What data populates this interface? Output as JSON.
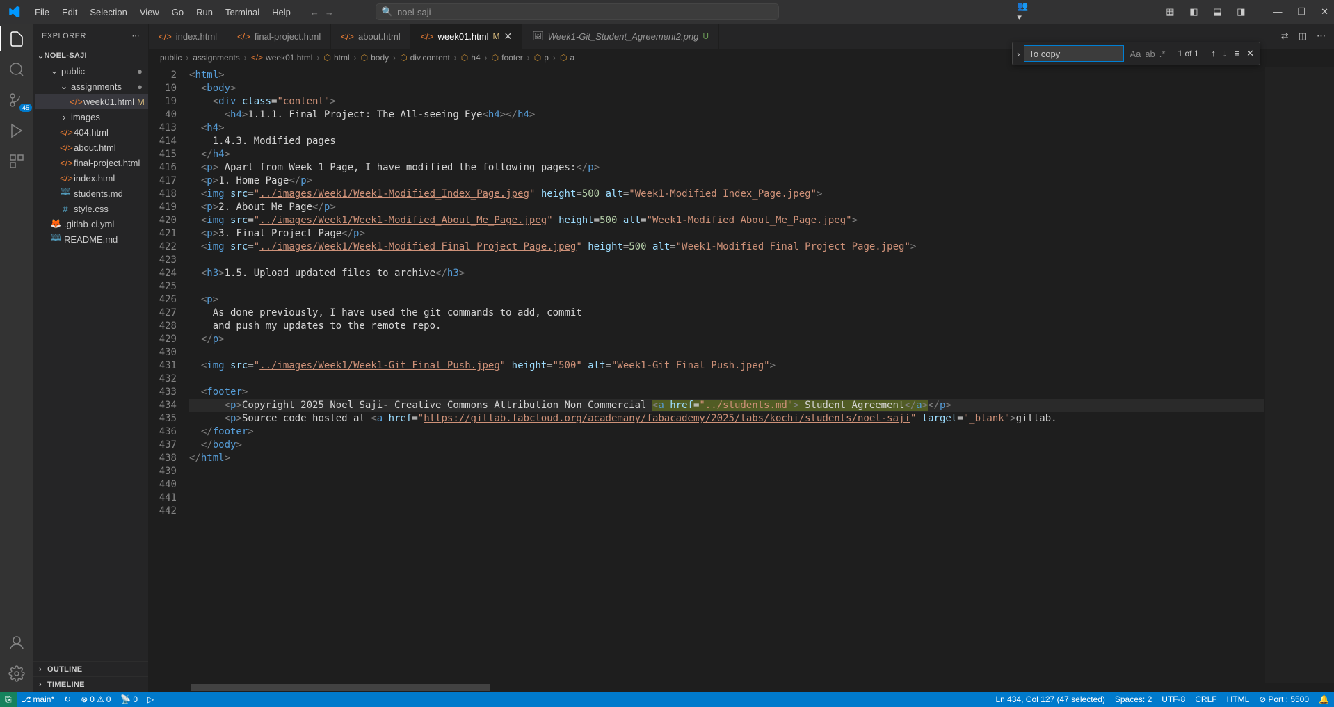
{
  "menubar": [
    "File",
    "Edit",
    "Selection",
    "View",
    "Go",
    "Run",
    "Terminal",
    "Help"
  ],
  "search_placeholder": "noel-saji",
  "activity_badge": "45",
  "explorer": {
    "title": "EXPLORER",
    "project": "NOEL-SAJI",
    "tree": [
      {
        "type": "folder",
        "name": "public",
        "indent": 1,
        "open": true,
        "dot": true
      },
      {
        "type": "folder",
        "name": "assignments",
        "indent": 2,
        "open": true,
        "dot": true
      },
      {
        "type": "file",
        "name": "week01.html",
        "indent": 3,
        "icon": "orange",
        "active": true,
        "status": "M"
      },
      {
        "type": "folder",
        "name": "images",
        "indent": 2,
        "open": false
      },
      {
        "type": "file",
        "name": "404.html",
        "indent": 2,
        "icon": "orange"
      },
      {
        "type": "file",
        "name": "about.html",
        "indent": 2,
        "icon": "orange"
      },
      {
        "type": "file",
        "name": "final-project.html",
        "indent": 2,
        "icon": "orange"
      },
      {
        "type": "file",
        "name": "index.html",
        "indent": 2,
        "icon": "orange"
      },
      {
        "type": "file",
        "name": "students.md",
        "indent": 2,
        "icon": "blue"
      },
      {
        "type": "file",
        "name": "style.css",
        "indent": 2,
        "icon": "blue"
      },
      {
        "type": "file",
        "name": ".gitlab-ci.yml",
        "indent": 1,
        "icon": "red"
      },
      {
        "type": "file",
        "name": "README.md",
        "indent": 1,
        "icon": "blue"
      }
    ],
    "sections": [
      "OUTLINE",
      "TIMELINE"
    ]
  },
  "tabs": [
    {
      "label": "index.html",
      "icon": "orange"
    },
    {
      "label": "final-project.html",
      "icon": "orange"
    },
    {
      "label": "about.html",
      "icon": "orange"
    },
    {
      "label": "week01.html",
      "icon": "orange",
      "active": true,
      "status": "M",
      "close": true
    },
    {
      "label": "Week1-Git_Student_Agreement2.png",
      "icon": "img",
      "status": "U",
      "italic": true
    }
  ],
  "breadcrumbs": [
    "public",
    "assignments",
    "week01.html",
    "html",
    "body",
    "div.content",
    "h4",
    "footer",
    "p",
    "a"
  ],
  "find": {
    "value": "To copy",
    "count": "1 of 1"
  },
  "gutter_lines": [
    "2",
    "10",
    "19",
    "40",
    "413",
    "414",
    "415",
    "416",
    "417",
    "418",
    "419",
    "420",
    "421",
    "422",
    "423",
    "424",
    "425",
    "426",
    "427",
    "428",
    "429",
    "430",
    "431",
    "432",
    "433",
    "434",
    "435",
    "436",
    "437",
    "438",
    "439",
    "440",
    "441",
    "442"
  ],
  "code_lines": [
    {
      "indent": 0,
      "html": "<span class='t-br'>&lt;</span><span class='t-tag'>html</span><span class='t-br'>&gt;</span>"
    },
    {
      "indent": 1,
      "html": "<span class='t-br'>&lt;</span><span class='t-tag'>body</span><span class='t-br'>&gt;</span>"
    },
    {
      "indent": 2,
      "html": "<span class='t-br'>&lt;</span><span class='t-tag'>div</span> <span class='t-attr'>class</span>=<span class='t-str'>\"content\"</span><span class='t-br'>&gt;</span>"
    },
    {
      "indent": 3,
      "html": "<span class='t-br'>&lt;</span><span class='t-tag'>h4</span><span class='t-br'>&gt;</span>1.1.1. Final Project: The All-seeing Eye<span class='t-br'>&lt;</span><span class='t-tag'>h4</span><span class='t-br'>&gt;&lt;/</span><span class='t-tag'>h4</span><span class='t-br'>&gt;</span>"
    },
    {
      "indent": 1,
      "html": "<span class='t-br'>&lt;</span><span class='t-tag'>h4</span><span class='t-br'>&gt;</span>"
    },
    {
      "indent": 2,
      "html": "1.4.3. Modified pages"
    },
    {
      "indent": 1,
      "html": "<span class='t-br'>&lt;/</span><span class='t-tag'>h4</span><span class='t-br'>&gt;</span>"
    },
    {
      "indent": 1,
      "html": "<span class='t-br'>&lt;</span><span class='t-tag'>p</span><span class='t-br'>&gt;</span> Apart from Week 1 Page, I have modified the following pages:<span class='t-br'>&lt;/</span><span class='t-tag'>p</span><span class='t-br'>&gt;</span>"
    },
    {
      "indent": 1,
      "html": "<span class='t-br'>&lt;</span><span class='t-tag'>p</span><span class='t-br'>&gt;</span>1. Home Page<span class='t-br'>&lt;/</span><span class='t-tag'>p</span><span class='t-br'>&gt;</span>"
    },
    {
      "indent": 1,
      "html": "<span class='t-br'>&lt;</span><span class='t-tag'>img</span> <span class='t-attr'>src</span>=<span class='t-str'>\"</span><span class='t-link'>../images/Week1/Week1-Modified_Index_Page.jpeg</span><span class='t-str'>\"</span> <span class='t-attr'>height</span>=<span class='t-num'>500</span> <span class='t-attr'>alt</span>=<span class='t-str'>\"Week1-Modified Index_Page.jpeg\"</span><span class='t-br'>&gt;</span>"
    },
    {
      "indent": 1,
      "html": "<span class='t-br'>&lt;</span><span class='t-tag'>p</span><span class='t-br'>&gt;</span>2. About Me Page<span class='t-br'>&lt;/</span><span class='t-tag'>p</span><span class='t-br'>&gt;</span>"
    },
    {
      "indent": 1,
      "html": "<span class='t-br'>&lt;</span><span class='t-tag'>img</span> <span class='t-attr'>src</span>=<span class='t-str'>\"</span><span class='t-link'>../images/Week1/Week1-Modified_About_Me_Page.jpeg</span><span class='t-str'>\"</span> <span class='t-attr'>height</span>=<span class='t-num'>500</span> <span class='t-attr'>alt</span>=<span class='t-str'>\"Week1-Modified About_Me_Page.jpeg\"</span><span class='t-br'>&gt;</span>"
    },
    {
      "indent": 1,
      "html": "<span class='t-br'>&lt;</span><span class='t-tag'>p</span><span class='t-br'>&gt;</span>3. Final Project Page<span class='t-br'>&lt;/</span><span class='t-tag'>p</span><span class='t-br'>&gt;</span>"
    },
    {
      "indent": 1,
      "html": "<span class='t-br'>&lt;</span><span class='t-tag'>img</span> <span class='t-attr'>src</span>=<span class='t-str'>\"</span><span class='t-link'>../images/Week1/Week1-Modified_Final_Project_Page.jpeg</span><span class='t-str'>\"</span> <span class='t-attr'>height</span>=<span class='t-num'>500</span> <span class='t-attr'>alt</span>=<span class='t-str'>\"Week1-Modified Final_Project_Page.jpeg\"</span><span class='t-br'>&gt;</span>"
    },
    {
      "indent": 1,
      "html": ""
    },
    {
      "indent": 1,
      "html": "<span class='t-br'>&lt;</span><span class='t-tag'>h3</span><span class='t-br'>&gt;</span>1.5. Upload updated files to archive<span class='t-br'>&lt;/</span><span class='t-tag'>h3</span><span class='t-br'>&gt;</span>"
    },
    {
      "indent": 1,
      "html": ""
    },
    {
      "indent": 1,
      "html": "<span class='t-br'>&lt;</span><span class='t-tag'>p</span><span class='t-br'>&gt;</span>"
    },
    {
      "indent": 2,
      "html": "As done previously, I have used the git commands to add, commit"
    },
    {
      "indent": 2,
      "html": "and push my updates to the remote repo."
    },
    {
      "indent": 1,
      "html": "<span class='t-br'>&lt;/</span><span class='t-tag'>p</span><span class='t-br'>&gt;</span>"
    },
    {
      "indent": 1,
      "html": ""
    },
    {
      "indent": 1,
      "html": "<span class='t-br'>&lt;</span><span class='t-tag'>img</span> <span class='t-attr'>src</span>=<span class='t-str'>\"</span><span class='t-link'>../images/Week1/Week1-Git_Final_Push.jpeg</span><span class='t-str'>\"</span> <span class='t-attr'>height</span>=<span class='t-str'>\"500\"</span> <span class='t-attr'>alt</span>=<span class='t-str'>\"Week1-Git_Final_Push.jpeg\"</span><span class='t-br'>&gt;</span>"
    },
    {
      "indent": 1,
      "html": ""
    },
    {
      "indent": 1,
      "html": "<span class='t-br'>&lt;</span><span class='t-tag'>footer</span><span class='t-br'>&gt;</span>"
    },
    {
      "indent": 3,
      "html": "<span class='t-br'>&lt;</span><span class='t-tag'>p</span><span class='t-br'>&gt;</span>Copyright 2025 Noel Saji- Creative Commons Attribution Non Commercial <span class='highlight-find'><span class='t-br'>&lt;</span><span class='t-tag'>a</span> <span class='t-attr'>href</span>=<span class='t-str'>\"../students.md\"</span><span class='t-br'>&gt;</span> Student Agreement<span class='t-br'>&lt;/</span><span class='t-tag'>a</span><span class='t-br'>&gt;</span></span><span class='t-br'>&lt;/</span><span class='t-tag'>p</span><span class='t-br'>&gt;</span>",
      "cursor": true
    },
    {
      "indent": 3,
      "html": "<span class='t-br'>&lt;</span><span class='t-tag'>p</span><span class='t-br'>&gt;</span>Source code hosted at <span class='t-br'>&lt;</span><span class='t-tag'>a</span> <span class='t-attr'>href</span>=<span class='t-str'>\"</span><span class='t-link'>https://gitlab.fabcloud.org/academany/fabacademy/2025/labs/kochi/students/noel-saji</span><span class='t-str'>\"</span> <span class='t-attr'>target</span>=<span class='t-str'>\"_blank\"</span><span class='t-br'>&gt;</span>gitlab."
    },
    {
      "indent": 1,
      "html": "<span class='t-br'>&lt;/</span><span class='t-tag'>footer</span><span class='t-br'>&gt;</span>"
    },
    {
      "indent": 1,
      "html": "<span class='t-br'>&lt;/</span><span class='t-tag'>body</span><span class='t-br'>&gt;</span>"
    },
    {
      "indent": 0,
      "html": "<span class='t-br'>&lt;/</span><span class='t-tag'>html</span><span class='t-br'>&gt;</span>"
    },
    {
      "indent": 0,
      "html": ""
    },
    {
      "indent": 0,
      "html": ""
    },
    {
      "indent": 0,
      "html": ""
    },
    {
      "indent": 0,
      "html": ""
    }
  ],
  "status": {
    "branch": "main*",
    "sync": "↻",
    "errors": "0",
    "warnings": "0",
    "radio": "0",
    "pos": "Ln 434, Col 127 (47 selected)",
    "spaces": "Spaces: 2",
    "encoding": "UTF-8",
    "eol": "CRLF",
    "lang": "HTML",
    "port": "Port : 5500"
  }
}
